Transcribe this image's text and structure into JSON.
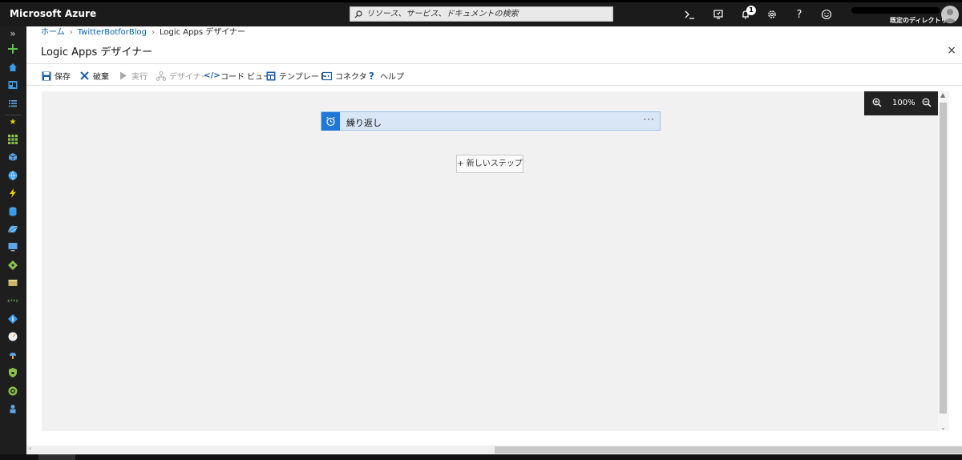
{
  "topbar": {
    "brand": "Microsoft Azure",
    "search_placeholder": "リソース、サービス、ドキュメントの検索",
    "notification_count": "1",
    "directory_label": "既定のディレクトリ"
  },
  "icons": {
    "cloud_shell": "cloud-shell-icon",
    "directory_filter": "directory-filter-icon",
    "notifications": "bell-icon",
    "settings": "gear-icon",
    "help": "question-icon",
    "feedback": "smiley-icon"
  },
  "leftnav": {
    "expand_label": "»"
  },
  "breadcrumb": {
    "items": [
      "ホーム",
      "TwitterBotforBlog",
      "Logic Apps デザイナー"
    ]
  },
  "blade": {
    "title": "Logic Apps デザイナー",
    "close": "×"
  },
  "toolbar": {
    "save": "保存",
    "discard": "破棄",
    "run": "実行",
    "designer": "デザイナー",
    "code_view": "コード ビュー",
    "templates": "テンプレート",
    "connectors": "コネクタ",
    "help": "ヘルプ"
  },
  "canvas": {
    "zoom_level": "100%",
    "trigger_title": "繰り返し",
    "trigger_menu": "···",
    "new_step": "+ 新しいステップ"
  },
  "colors": {
    "topbar_bg": "#1b1b1b",
    "accent": "#1f77d8",
    "trigger_bg": "#d8e6f6",
    "canvas_bg": "#f1f1f1"
  }
}
